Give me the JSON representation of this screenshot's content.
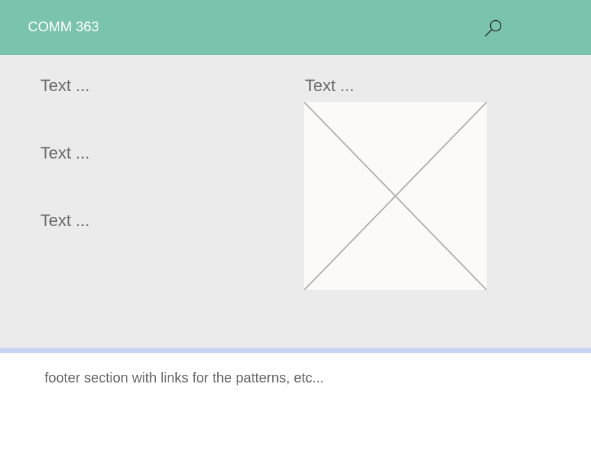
{
  "header": {
    "title": "COMM 363",
    "search_icon": "search-icon",
    "background_color": "#7ac3ad"
  },
  "main": {
    "left_column": {
      "items": [
        "Text ...",
        "Text ...",
        "Text ..."
      ]
    },
    "right_column": {
      "label": "Text ...",
      "image_placeholder_icon": "image-placeholder-x"
    },
    "background_color": "#ebebeb"
  },
  "footer": {
    "text": "footer section with links for the patterns, etc...",
    "divider_color": "#c9d5f6"
  }
}
